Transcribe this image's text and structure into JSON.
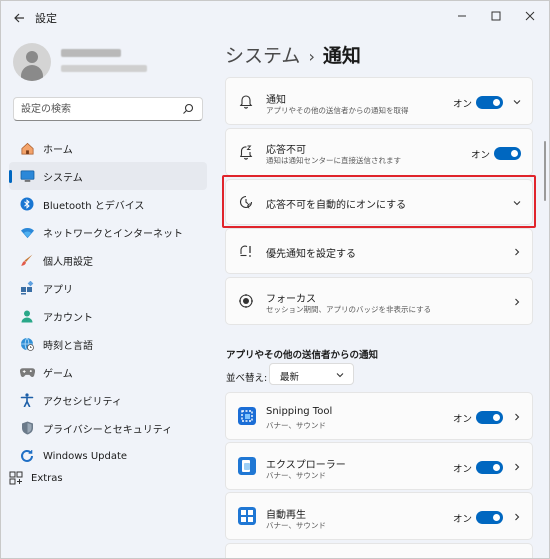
{
  "window": {
    "title": "設定"
  },
  "profile": {
    "name_redacted": "",
    "email_redacted": ""
  },
  "search": {
    "placeholder": "設定の検索"
  },
  "sidebar": {
    "items": [
      {
        "label": "ホーム",
        "icon": "home-icon"
      },
      {
        "label": "システム",
        "icon": "system-icon",
        "active": true
      },
      {
        "label": "Bluetooth とデバイス",
        "icon": "bluetooth-icon"
      },
      {
        "label": "ネットワークとインターネット",
        "icon": "wifi-icon"
      },
      {
        "label": "個人用設定",
        "icon": "brush-icon"
      },
      {
        "label": "アプリ",
        "icon": "apps-icon"
      },
      {
        "label": "アカウント",
        "icon": "account-icon"
      },
      {
        "label": "時刻と言語",
        "icon": "globe-clock-icon"
      },
      {
        "label": "ゲーム",
        "icon": "gamepad-icon"
      },
      {
        "label": "アクセシビリティ",
        "icon": "accessibility-icon"
      },
      {
        "label": "プライバシーとセキュリティ",
        "icon": "shield-icon"
      },
      {
        "label": "Windows Update",
        "icon": "update-icon"
      }
    ],
    "extras": {
      "label": "Extras",
      "icon": "extras-icon"
    }
  },
  "breadcrumb": {
    "parent": "システム",
    "separator": "›",
    "current": "通知"
  },
  "cards": {
    "notifications": {
      "title": "通知",
      "subtitle": "アプリやその他の送信者からの通知を取得",
      "state": "オン",
      "on": true
    },
    "dnd": {
      "title": "応答不可",
      "subtitle": "通知は通知センターに直接送信されます",
      "state": "オン",
      "on": true
    },
    "auto_dnd": {
      "title": "応答不可を自動的にオンにする"
    },
    "priority": {
      "title": "優先通知を設定する"
    },
    "focus": {
      "title": "フォーカス",
      "subtitle": "セッション期間、アプリのバッジを非表示にする"
    }
  },
  "senders": {
    "section_title": "アプリやその他の送信者からの通知",
    "sort_label": "並べ替え:",
    "sort_value": "最新",
    "items": [
      {
        "title": "Snipping Tool",
        "subtitle": "バナー、サウンド",
        "state": "オン",
        "on": true,
        "icon": "snipping-tool-icon"
      },
      {
        "title": "エクスプローラー",
        "subtitle": "バナー、サウンド",
        "state": "オン",
        "on": true,
        "icon": "file-explorer-icon"
      },
      {
        "title": "自動再生",
        "subtitle": "バナー、サウンド",
        "state": "オン",
        "on": true,
        "icon": "autoplay-icon"
      }
    ]
  },
  "colors": {
    "accent": "#0067c0",
    "highlight": "#e0242b"
  }
}
